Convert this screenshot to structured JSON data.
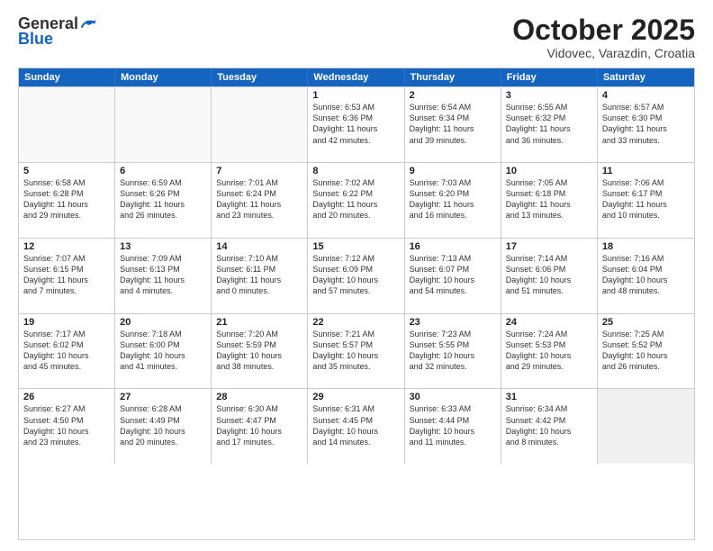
{
  "header": {
    "logo_general": "General",
    "logo_blue": "Blue",
    "month_title": "October 2025",
    "location": "Vidovec, Varazdin, Croatia"
  },
  "weekdays": [
    "Sunday",
    "Monday",
    "Tuesday",
    "Wednesday",
    "Thursday",
    "Friday",
    "Saturday"
  ],
  "rows": [
    [
      {
        "day": "",
        "info": "",
        "empty": true
      },
      {
        "day": "",
        "info": "",
        "empty": true
      },
      {
        "day": "",
        "info": "",
        "empty": true
      },
      {
        "day": "1",
        "info": "Sunrise: 6:53 AM\nSunset: 6:36 PM\nDaylight: 11 hours\nand 42 minutes."
      },
      {
        "day": "2",
        "info": "Sunrise: 6:54 AM\nSunset: 6:34 PM\nDaylight: 11 hours\nand 39 minutes."
      },
      {
        "day": "3",
        "info": "Sunrise: 6:55 AM\nSunset: 6:32 PM\nDaylight: 11 hours\nand 36 minutes."
      },
      {
        "day": "4",
        "info": "Sunrise: 6:57 AM\nSunset: 6:30 PM\nDaylight: 11 hours\nand 33 minutes."
      }
    ],
    [
      {
        "day": "5",
        "info": "Sunrise: 6:58 AM\nSunset: 6:28 PM\nDaylight: 11 hours\nand 29 minutes."
      },
      {
        "day": "6",
        "info": "Sunrise: 6:59 AM\nSunset: 6:26 PM\nDaylight: 11 hours\nand 26 minutes."
      },
      {
        "day": "7",
        "info": "Sunrise: 7:01 AM\nSunset: 6:24 PM\nDaylight: 11 hours\nand 23 minutes."
      },
      {
        "day": "8",
        "info": "Sunrise: 7:02 AM\nSunset: 6:22 PM\nDaylight: 11 hours\nand 20 minutes."
      },
      {
        "day": "9",
        "info": "Sunrise: 7:03 AM\nSunset: 6:20 PM\nDaylight: 11 hours\nand 16 minutes."
      },
      {
        "day": "10",
        "info": "Sunrise: 7:05 AM\nSunset: 6:18 PM\nDaylight: 11 hours\nand 13 minutes."
      },
      {
        "day": "11",
        "info": "Sunrise: 7:06 AM\nSunset: 6:17 PM\nDaylight: 11 hours\nand 10 minutes."
      }
    ],
    [
      {
        "day": "12",
        "info": "Sunrise: 7:07 AM\nSunset: 6:15 PM\nDaylight: 11 hours\nand 7 minutes."
      },
      {
        "day": "13",
        "info": "Sunrise: 7:09 AM\nSunset: 6:13 PM\nDaylight: 11 hours\nand 4 minutes."
      },
      {
        "day": "14",
        "info": "Sunrise: 7:10 AM\nSunset: 6:11 PM\nDaylight: 11 hours\nand 0 minutes."
      },
      {
        "day": "15",
        "info": "Sunrise: 7:12 AM\nSunset: 6:09 PM\nDaylight: 10 hours\nand 57 minutes."
      },
      {
        "day": "16",
        "info": "Sunrise: 7:13 AM\nSunset: 6:07 PM\nDaylight: 10 hours\nand 54 minutes."
      },
      {
        "day": "17",
        "info": "Sunrise: 7:14 AM\nSunset: 6:06 PM\nDaylight: 10 hours\nand 51 minutes."
      },
      {
        "day": "18",
        "info": "Sunrise: 7:16 AM\nSunset: 6:04 PM\nDaylight: 10 hours\nand 48 minutes."
      }
    ],
    [
      {
        "day": "19",
        "info": "Sunrise: 7:17 AM\nSunset: 6:02 PM\nDaylight: 10 hours\nand 45 minutes."
      },
      {
        "day": "20",
        "info": "Sunrise: 7:18 AM\nSunset: 6:00 PM\nDaylight: 10 hours\nand 41 minutes."
      },
      {
        "day": "21",
        "info": "Sunrise: 7:20 AM\nSunset: 5:59 PM\nDaylight: 10 hours\nand 38 minutes."
      },
      {
        "day": "22",
        "info": "Sunrise: 7:21 AM\nSunset: 5:57 PM\nDaylight: 10 hours\nand 35 minutes."
      },
      {
        "day": "23",
        "info": "Sunrise: 7:23 AM\nSunset: 5:55 PM\nDaylight: 10 hours\nand 32 minutes."
      },
      {
        "day": "24",
        "info": "Sunrise: 7:24 AM\nSunset: 5:53 PM\nDaylight: 10 hours\nand 29 minutes."
      },
      {
        "day": "25",
        "info": "Sunrise: 7:25 AM\nSunset: 5:52 PM\nDaylight: 10 hours\nand 26 minutes."
      }
    ],
    [
      {
        "day": "26",
        "info": "Sunrise: 6:27 AM\nSunset: 4:50 PM\nDaylight: 10 hours\nand 23 minutes."
      },
      {
        "day": "27",
        "info": "Sunrise: 6:28 AM\nSunset: 4:49 PM\nDaylight: 10 hours\nand 20 minutes."
      },
      {
        "day": "28",
        "info": "Sunrise: 6:30 AM\nSunset: 4:47 PM\nDaylight: 10 hours\nand 17 minutes."
      },
      {
        "day": "29",
        "info": "Sunrise: 6:31 AM\nSunset: 4:45 PM\nDaylight: 10 hours\nand 14 minutes."
      },
      {
        "day": "30",
        "info": "Sunrise: 6:33 AM\nSunset: 4:44 PM\nDaylight: 10 hours\nand 11 minutes."
      },
      {
        "day": "31",
        "info": "Sunrise: 6:34 AM\nSunset: 4:42 PM\nDaylight: 10 hours\nand 8 minutes."
      },
      {
        "day": "",
        "info": "",
        "empty": true,
        "shaded": true
      }
    ]
  ]
}
